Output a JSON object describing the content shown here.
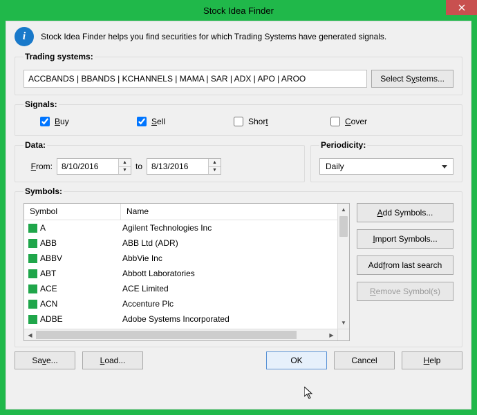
{
  "window": {
    "title": "Stock Idea Finder"
  },
  "info": {
    "text": "Stock Idea Finder helps you find securities for which Trading Systems have generated signals."
  },
  "sections": {
    "trading_systems": "Trading systems:",
    "signals": "Signals:",
    "data": "Data:",
    "periodicity": "Periodicity:",
    "symbols": "Symbols:"
  },
  "systems": {
    "value": "ACCBANDS | BBANDS | KCHANNELS | MAMA | SAR | ADX | APO | AROO",
    "select_btn": "Select Systems..."
  },
  "signals": {
    "buy": {
      "label": "Buy",
      "checked": true
    },
    "sell": {
      "label": "Sell",
      "checked": true
    },
    "short": {
      "label": "Short",
      "checked": false
    },
    "cover": {
      "label": "Cover",
      "checked": false
    }
  },
  "data": {
    "from_label": "From:",
    "from_value": "8/10/2016",
    "to_label": "to",
    "to_value": "8/13/2016"
  },
  "periodicity": {
    "value": "Daily"
  },
  "symbols": {
    "headers": {
      "symbol": "Symbol",
      "name": "Name"
    },
    "rows": [
      {
        "symbol": "A",
        "name": "Agilent Technologies Inc"
      },
      {
        "symbol": "ABB",
        "name": "ABB Ltd (ADR)"
      },
      {
        "symbol": "ABBV",
        "name": "AbbVie Inc"
      },
      {
        "symbol": "ABT",
        "name": "Abbott Laboratories"
      },
      {
        "symbol": "ACE",
        "name": "ACE Limited"
      },
      {
        "symbol": "ACN",
        "name": "Accenture Plc"
      },
      {
        "symbol": "ADBE",
        "name": "Adobe Systems Incorporated"
      }
    ],
    "buttons": {
      "add": "Add Symbols...",
      "import": "Import Symbols...",
      "add_last": "Add from last search",
      "remove": "Remove Symbol(s)"
    }
  },
  "footer": {
    "save": "Save...",
    "load": "Load...",
    "ok": "OK",
    "cancel": "Cancel",
    "help": "Help"
  }
}
